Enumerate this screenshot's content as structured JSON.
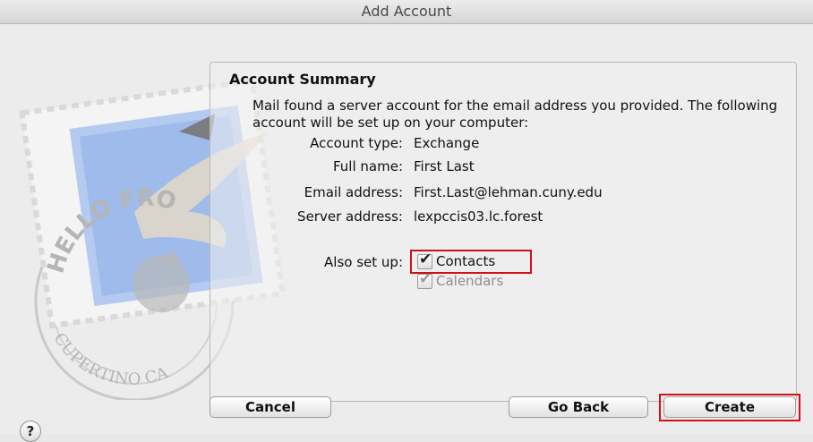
{
  "window": {
    "title": "Add Account"
  },
  "summary": {
    "heading": "Account Summary",
    "description": "Mail found a server account for the email address you provided.  The following account will be set up on your computer:",
    "fields": [
      {
        "label": "Account type:",
        "value": "Exchange"
      },
      {
        "label": "Full name:",
        "value": "First Last"
      },
      {
        "label": "Email address:",
        "value": "First.Last@lehman.cuny.edu"
      },
      {
        "label": "Server address:",
        "value": "lexpccis03.lc.forest"
      }
    ],
    "also_setup": {
      "label": "Also set up:",
      "options": [
        {
          "label": "Contacts",
          "checked": true,
          "enabled": true
        },
        {
          "label": "Calendars",
          "checked": true,
          "enabled": false
        }
      ]
    }
  },
  "stamp": {
    "top_text": "HELLO FRO",
    "bottom_text": "CUPERTINO CA"
  },
  "buttons": {
    "help": "?",
    "cancel": "Cancel",
    "go_back": "Go Back",
    "create": "Create"
  },
  "colors": {
    "highlight": "#d0111b",
    "stamp_blue": "#8fb0e8"
  },
  "icons": {
    "stamp": "mail-stamp-icon",
    "check": "checkmark-icon",
    "help": "question-icon"
  }
}
